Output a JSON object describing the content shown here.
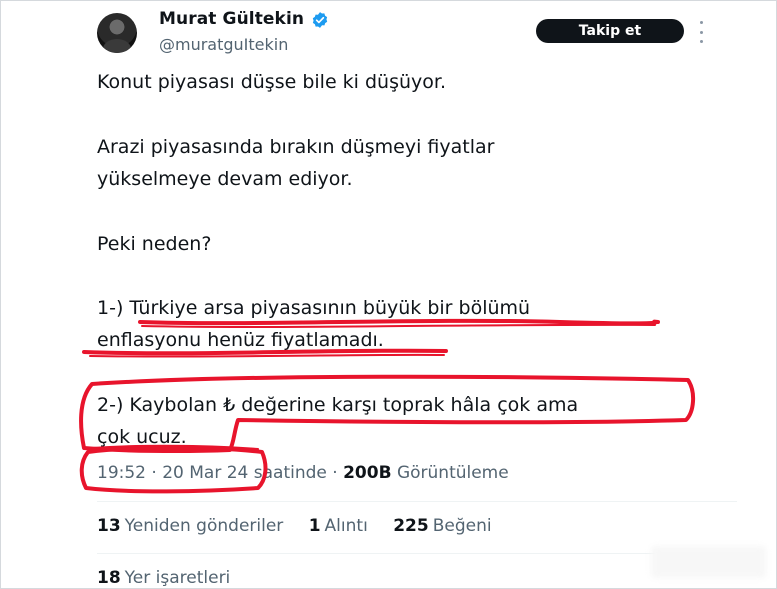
{
  "author": {
    "display_name": "Murat Gültekin",
    "handle": "@muratguItekin",
    "verified": true
  },
  "header": {
    "follow_label": "Takip et"
  },
  "tweet": {
    "lines": [
      "Konut piyasası düşse bile ki düşüyor.",
      "Arazi piyasasında bırakın düşmeyi fiyatlar",
      "yükselmeye devam ediyor.",
      "Peki neden?",
      " 1-) Türkiye arsa piyasasının büyük bir bölümü",
      "enflasyonu henüz fiyatlamadı.",
      "2-) Kaybolan ₺ değerine karşı toprak hâla çok ama",
      "çok ucuz."
    ]
  },
  "meta": {
    "time": "19:52 · 20 Mar 24",
    "suffix": " saatinde · ",
    "views": "200B",
    "views_label": " Görüntüleme"
  },
  "stats": {
    "reposts_count": "13",
    "reposts_label": "Yeniden gönderiler",
    "quotes_count": "1",
    "quotes_label": "Alıntı",
    "likes_count": "225",
    "likes_label": "Beğeni",
    "bookmarks_count": "18",
    "bookmarks_label": "Yer işaretleri"
  },
  "colors": {
    "annotation_red": "#e8142c",
    "verified_blue": "#1d9bf0",
    "text_primary": "#0f1419",
    "text_secondary": "#536471"
  }
}
